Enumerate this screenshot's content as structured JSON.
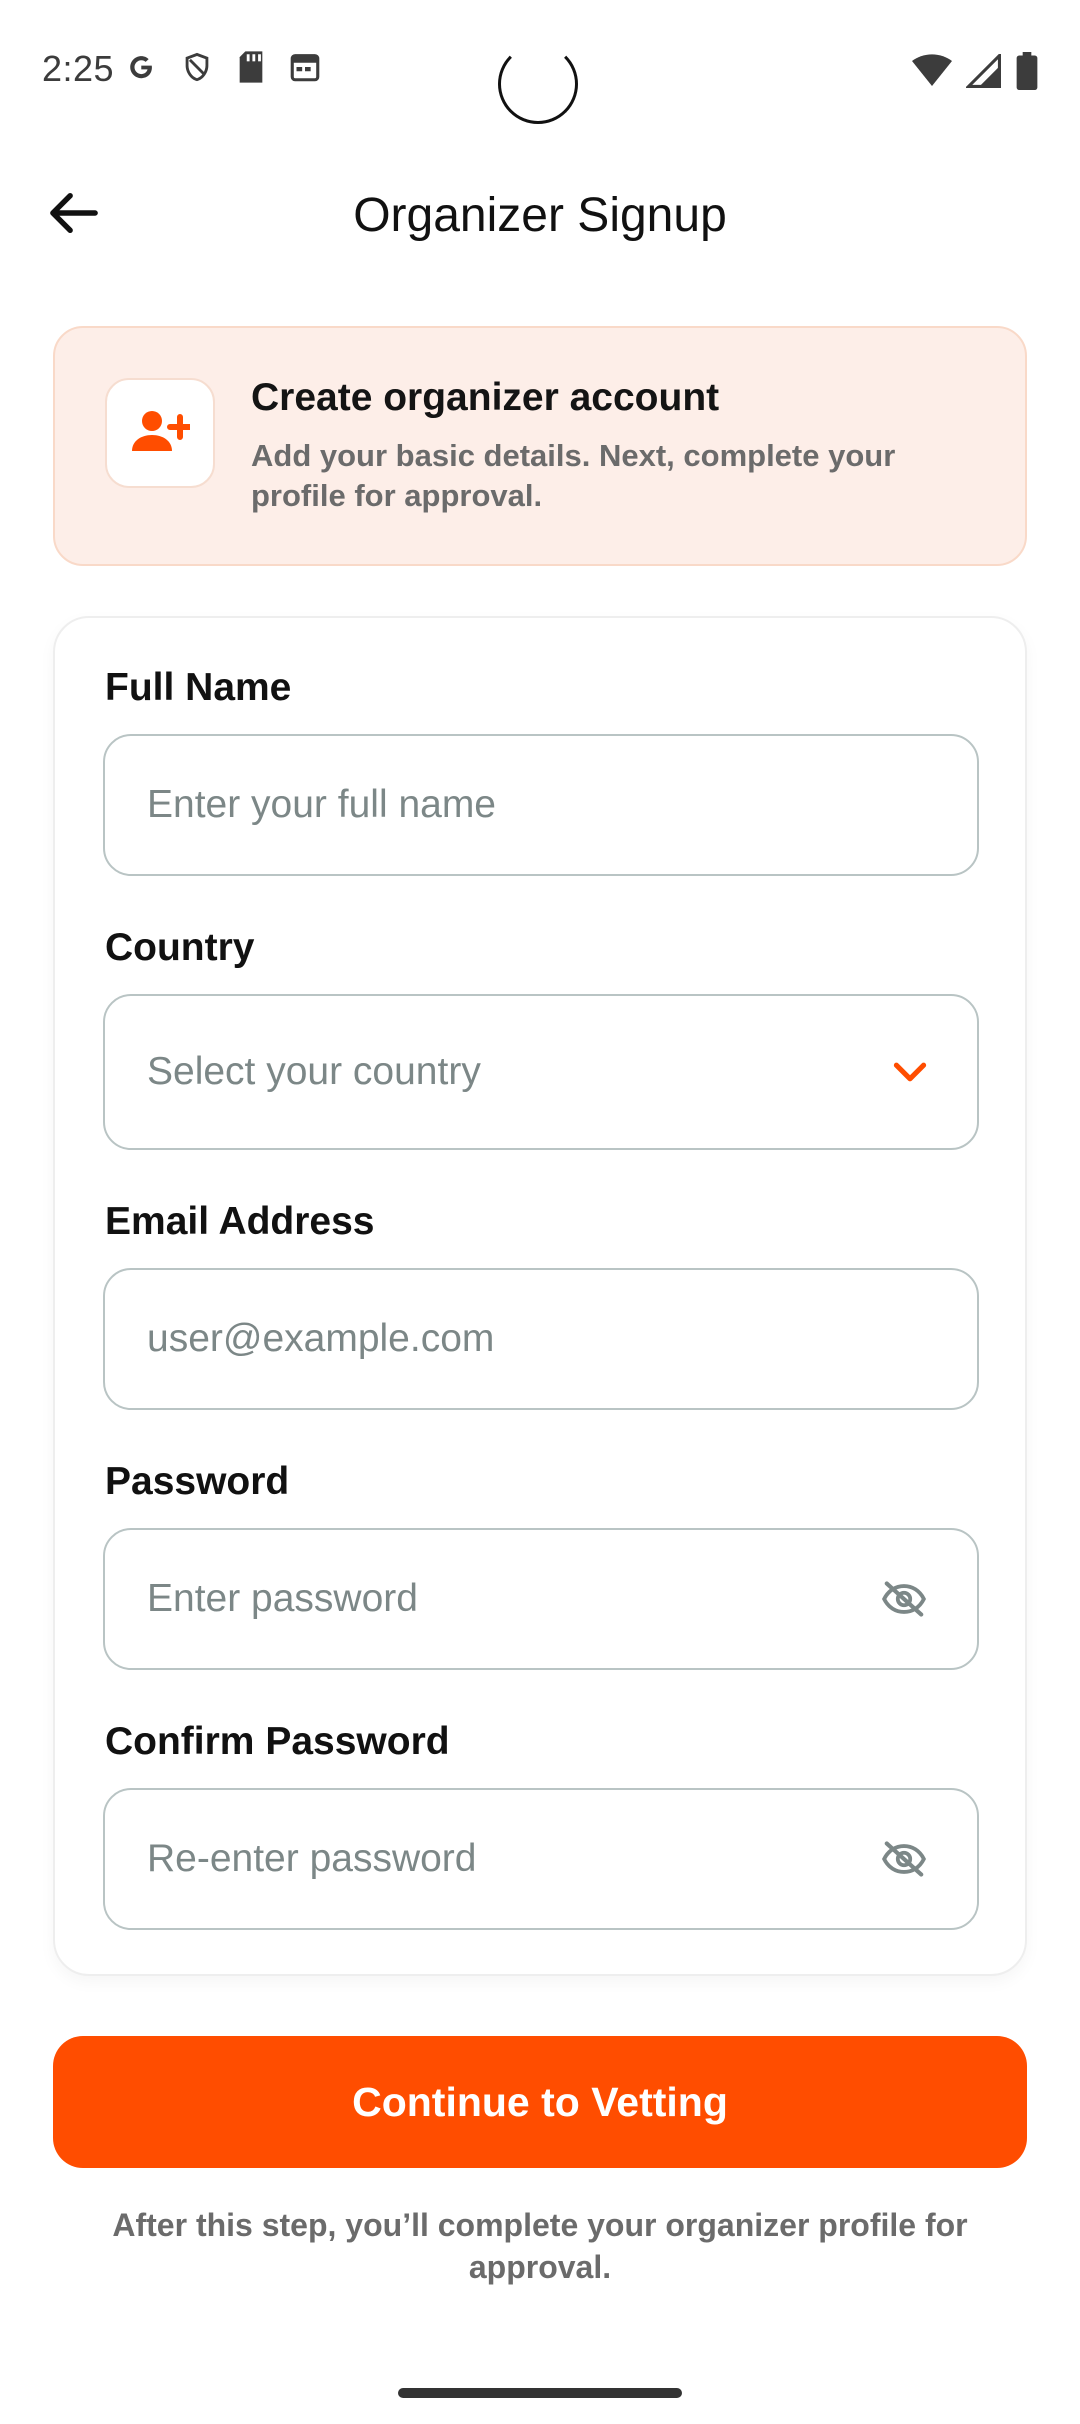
{
  "status_bar": {
    "time": "2:25",
    "icons_left": [
      "google-icon",
      "shield-icon",
      "sd-card-icon",
      "calendar-icon"
    ],
    "icons_right": [
      "wifi-icon",
      "signal-icon",
      "battery-icon"
    ]
  },
  "app_bar": {
    "title": "Organizer Signup",
    "back_icon": "arrow-left-icon"
  },
  "banner": {
    "icon": "person-add-icon",
    "title": "Create organizer account",
    "description": "Add your basic details. Next, complete your profile for approval."
  },
  "form": {
    "full_name": {
      "label": "Full Name",
      "placeholder": "Enter your full name",
      "value": ""
    },
    "country": {
      "label": "Country",
      "placeholder": "Select your country",
      "value": "",
      "trailing_icon": "chevron-down-icon"
    },
    "email": {
      "label": "Email Address",
      "placeholder": "user@example.com",
      "value": ""
    },
    "password": {
      "label": "Password",
      "placeholder": "Enter password",
      "value": "",
      "trailing_icon": "eye-off-icon"
    },
    "confirm_password": {
      "label": "Confirm Password",
      "placeholder": "Re-enter password",
      "value": "",
      "trailing_icon": "eye-off-icon"
    }
  },
  "cta": {
    "label": "Continue to Vetting"
  },
  "footnote": "After this step, you’ll complete your organizer profile for approval.",
  "colors": {
    "accent": "#FF4D00",
    "banner_bg": "#FDEEE8",
    "input_border": "#B9C4C4",
    "placeholder": "#7C8787"
  }
}
